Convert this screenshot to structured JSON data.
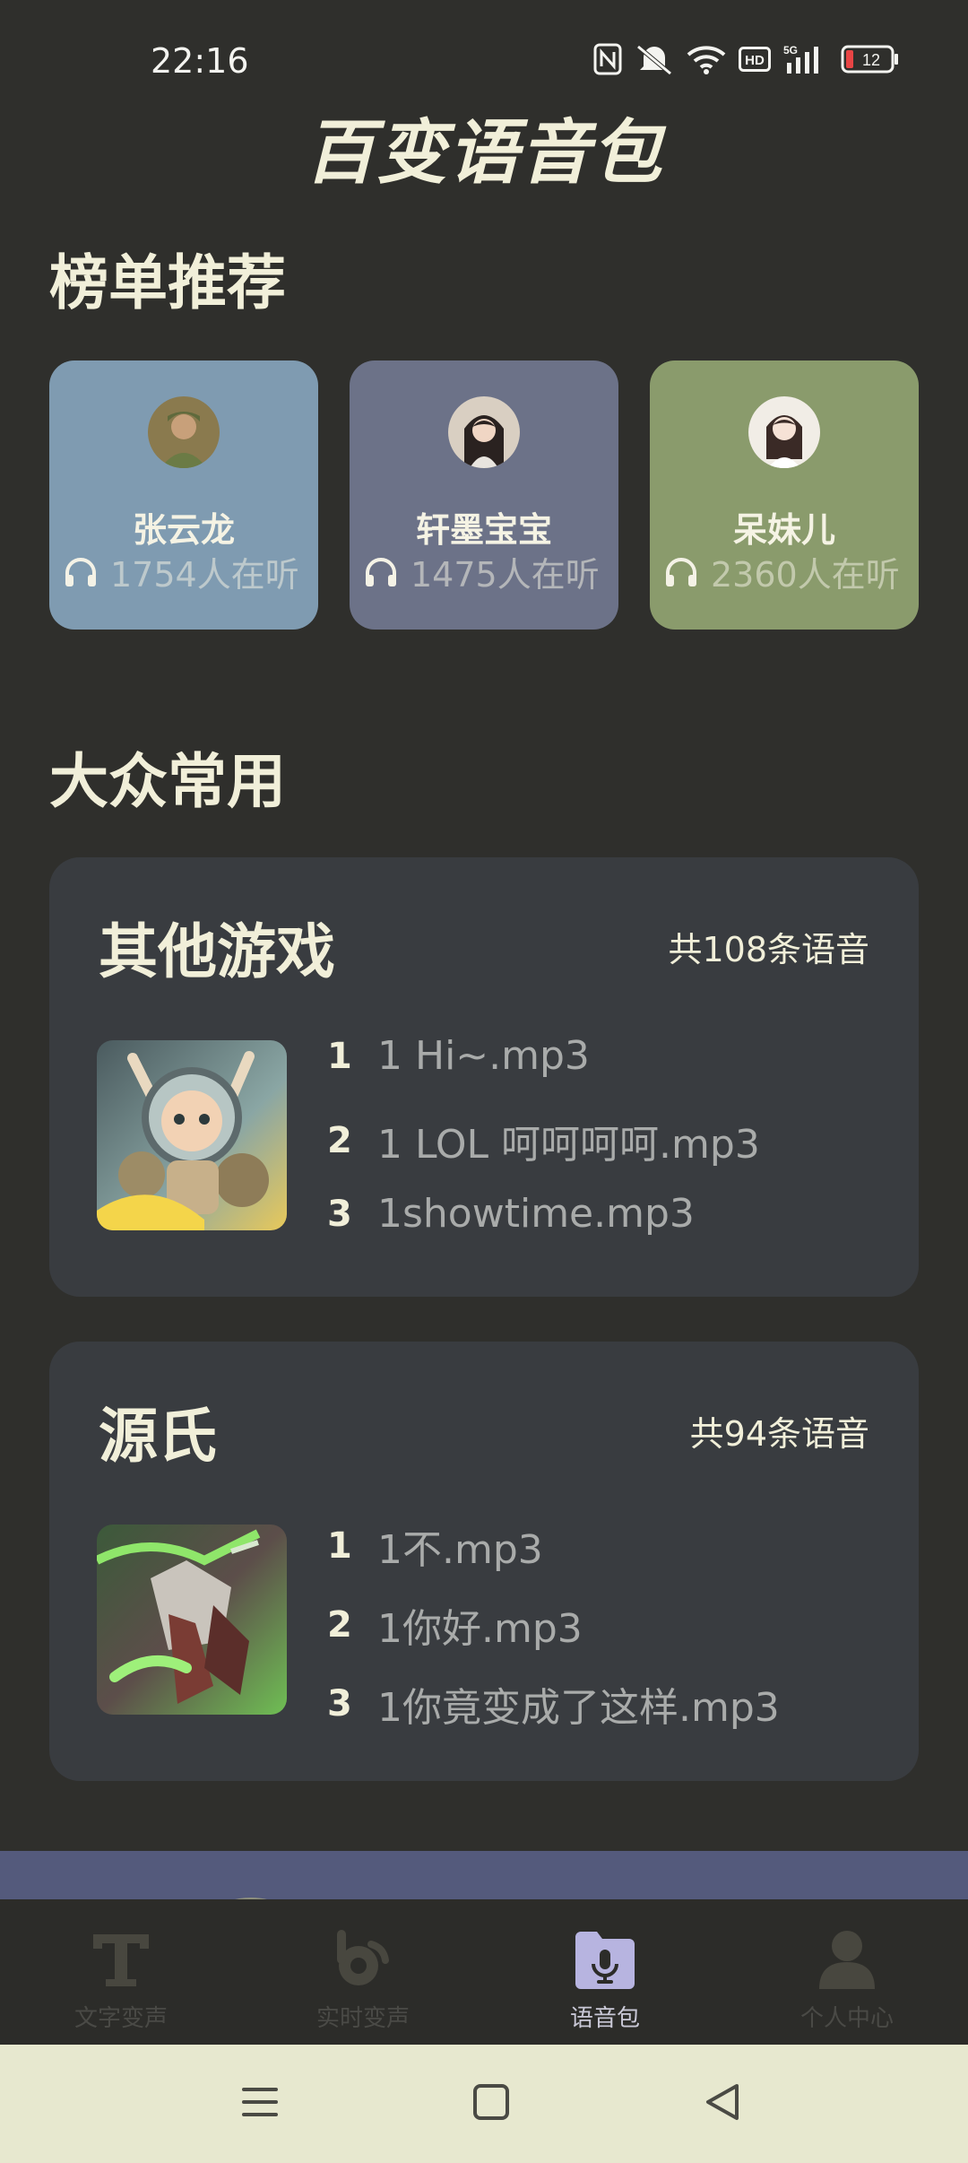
{
  "status": {
    "time": "22:16",
    "battery": "12"
  },
  "app": {
    "title": "百变语音包"
  },
  "sections": {
    "ranking_title": "榜单推荐",
    "popular_title": "大众常用"
  },
  "ranking": [
    {
      "name": "张云龙",
      "listeners": "1754人在听",
      "bg": "#7f9bb1"
    },
    {
      "name": "轩墨宝宝",
      "listeners": "1475人在听",
      "bg": "#6c7288"
    },
    {
      "name": "呆妹儿",
      "listeners": "2360人在听",
      "bg": "#8a9b6c"
    }
  ],
  "packs": [
    {
      "name": "其他游戏",
      "count": "共108条语音",
      "items": [
        {
          "index": "1",
          "title": "1 Hi~.mp3"
        },
        {
          "index": "2",
          "title": "1 LOL 呵呵呵呵.mp3"
        },
        {
          "index": "3",
          "title": "1showtime.mp3"
        }
      ]
    },
    {
      "name": "源氏",
      "count": "共94条语音",
      "items": [
        {
          "index": "1",
          "title": "1不.mp3"
        },
        {
          "index": "2",
          "title": "1你好.mp3"
        },
        {
          "index": "3",
          "title": "1你竟变成了这样.mp3"
        }
      ]
    }
  ],
  "nav": [
    {
      "label": "文字变声",
      "icon": "text-voice-icon",
      "active": false
    },
    {
      "label": "实时变声",
      "icon": "realtime-voice-icon",
      "active": false
    },
    {
      "label": "语音包",
      "icon": "voice-pack-icon",
      "active": true
    },
    {
      "label": "个人中心",
      "icon": "profile-icon",
      "active": false
    }
  ],
  "colors": {
    "background": "#2f2f2c",
    "accent": "#b7b4e0",
    "card": "#393c40"
  }
}
